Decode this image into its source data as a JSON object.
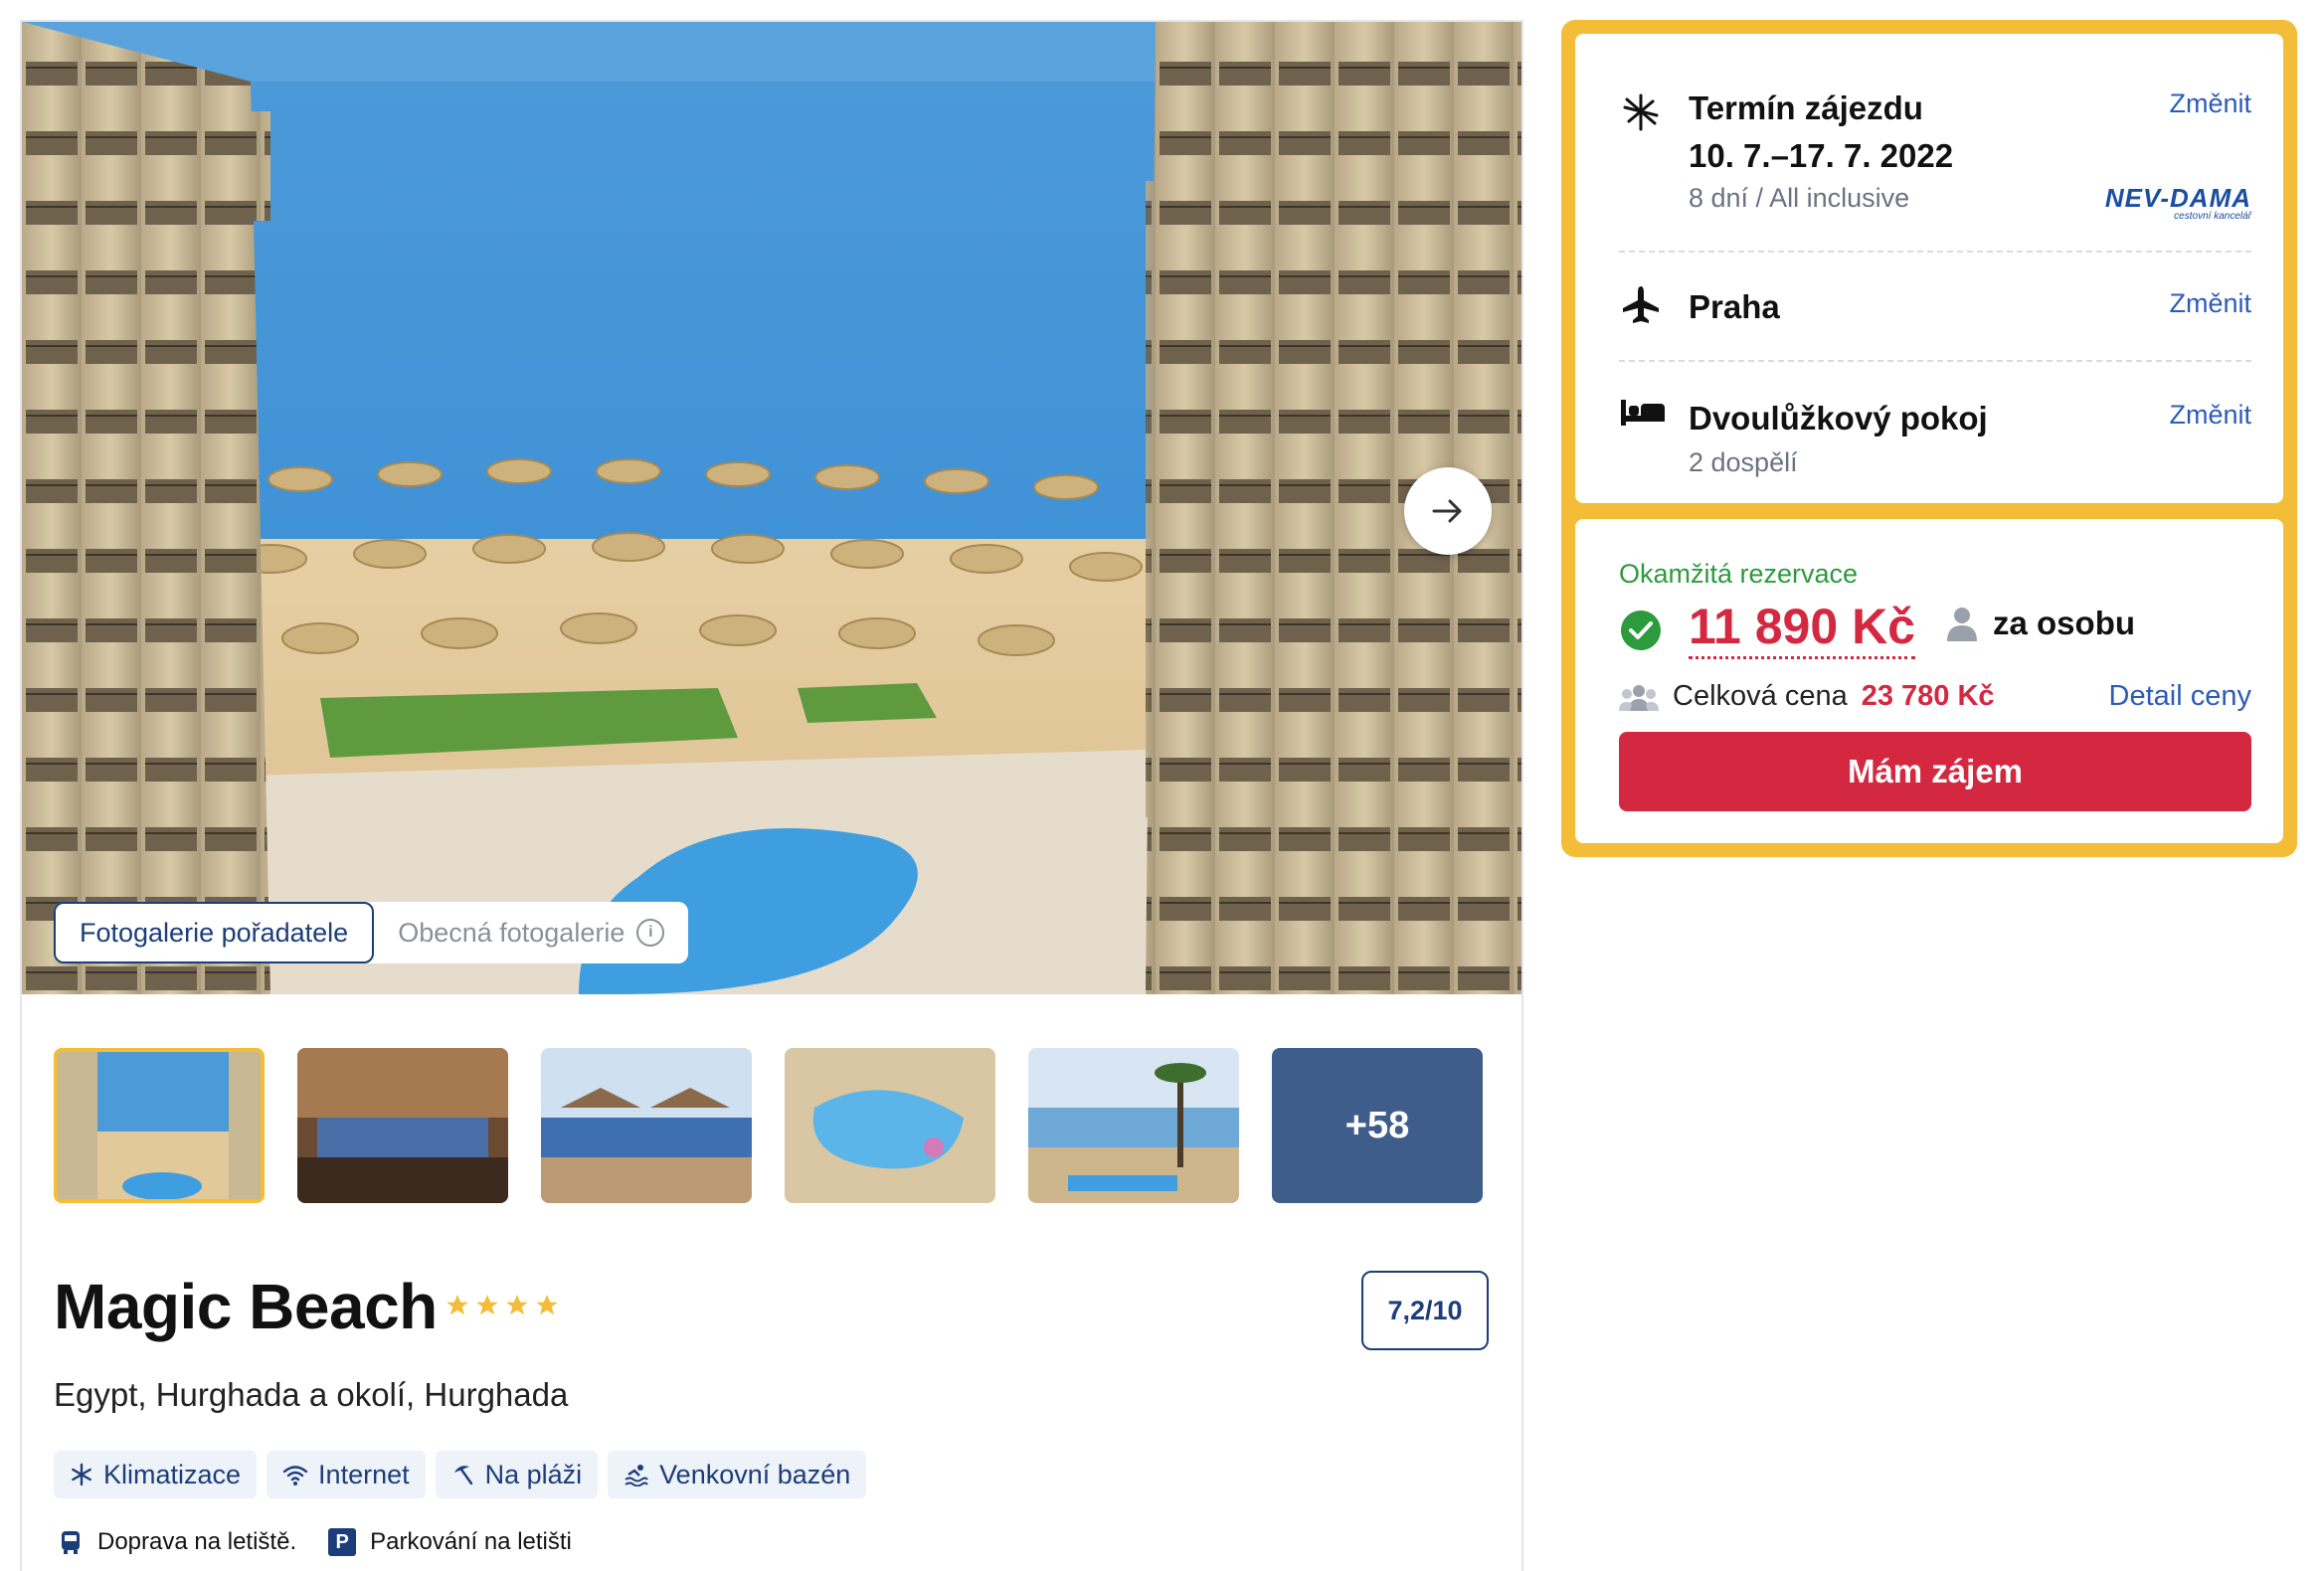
{
  "gallery": {
    "tabs": [
      {
        "label": "Fotogalerie pořadatele",
        "active": true
      },
      {
        "label": "Obecná fotogalerie",
        "active": false
      }
    ],
    "more_count": "+58",
    "next_icon": "arrow-right-icon"
  },
  "hotel": {
    "name": "Magic Beach",
    "stars": 4,
    "rating": "7,2/10",
    "location": "Egypt, Hurghada a okolí, Hurghada",
    "amenities": [
      {
        "label": "Klimatizace",
        "icon": "snowflake-icon"
      },
      {
        "label": "Internet",
        "icon": "wifi-icon"
      },
      {
        "label": "Na pláži",
        "icon": "beach-umbrella-icon"
      },
      {
        "label": "Venkovní bazén",
        "icon": "pool-icon"
      }
    ],
    "services": [
      {
        "label": "Doprava na letiště.",
        "icon": "bus-icon"
      },
      {
        "label": "Parkování na letišti",
        "icon": "parking-icon",
        "glyph": "P"
      }
    ]
  },
  "booking": {
    "term": {
      "title": "Termín zájezdu",
      "dates": "10. 7.–17. 7. 2022",
      "sub": "8 dní / All inclusive",
      "change": "Změnit",
      "agency_logo": "NEV-DAMA",
      "agency_sub": "cestovní kancelář"
    },
    "departure": {
      "title": "Praha",
      "change": "Změnit"
    },
    "room": {
      "title": "Dvoulůžkový pokoj",
      "sub": "2 dospělí",
      "change": "Změnit"
    },
    "price": {
      "instant": "Okamžitá rezervace",
      "per_person_value": "11 890 Kč",
      "per_person_label": "za osobu",
      "total_label": "Celková cena",
      "total_value": "23 780 Kč",
      "detail_link": "Detail ceny",
      "cta": "Mám zájem"
    }
  },
  "colors": {
    "accent_yellow": "#f4bd38",
    "brand_blue": "#1b3d7a",
    "link_blue": "#2c5cb8",
    "price_red": "#d42840",
    "success_green": "#2c9a3d"
  }
}
